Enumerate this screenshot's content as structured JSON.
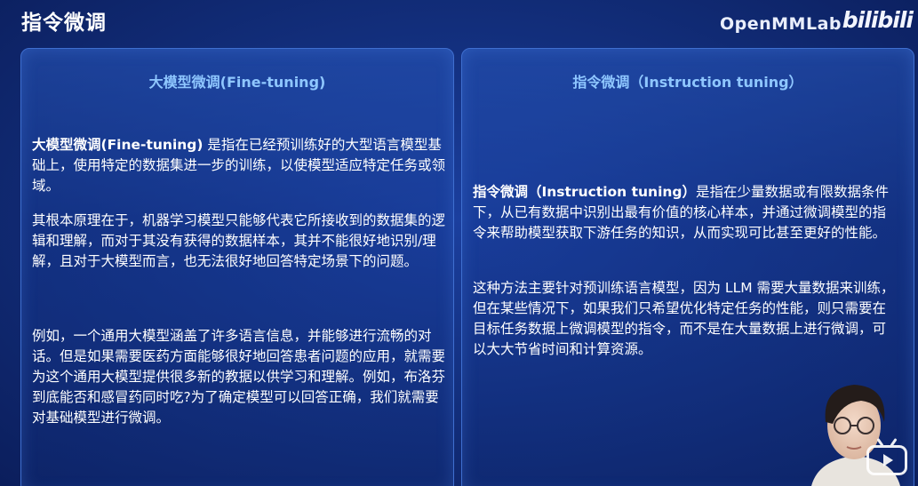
{
  "header": {
    "title": "指令微调",
    "brand": "OpenMMLab",
    "platform": "bilibili"
  },
  "left_card": {
    "heading": "大模型微调(Fine-tuning)",
    "p1_bold": "大模型微调(Fine-tuning)",
    "p1_rest": " 是指在已经预训练好的大型语言模型基础上，使用特定的数据集进一步的训练，以使模型适应特定任务或领域。",
    "p2": "其根本原理在于，机器学习模型只能够代表它所接收到的数据集的逻辑和理解，而对于其没有获得的数据样本，其并不能很好地识别/理解，且对于大模型而言，也无法很好地回答特定场景下的问题。",
    "p3": "例如，一个通用大模型涵盖了许多语言信息，并能够进行流畅的对话。但是如果需要医药方面能够很好地回答患者问题的应用，就需要为这个通用大模型提供很多新的教据以供学习和理解。例如，布洛芬到底能否和感冒药同时吃?为了确定模型可以回答正确，我们就需要对基础模型进行微调。"
  },
  "right_card": {
    "heading": "指令微调（Instruction tuning）",
    "p1_bold": "指令微调（Instruction tuning）",
    "p1_rest": "是指在少量数据或有限数据条件下，从已有数据中识别出最有价值的核心样本，并通过微调模型的指令来帮助模型获取下游任务的知识，从而实现可比甚至更好的性能。",
    "p2": "这种方法主要针对预训练语言模型，因为 LLM 需要大量数据来训练，但在某些情况下，如果我们只希望优化特定任务的性能，则只需要在目标任务数据上微调模型的指令，而不是在大量数据上进行微调，可以大大节省时间和计算资源。"
  },
  "icons": {
    "video_overlay": "tv-play-icon"
  },
  "colors": {
    "background": "#13307f",
    "card_border": "#3f6fd0",
    "heading": "#8fc7ff",
    "text": "#ffffff"
  }
}
